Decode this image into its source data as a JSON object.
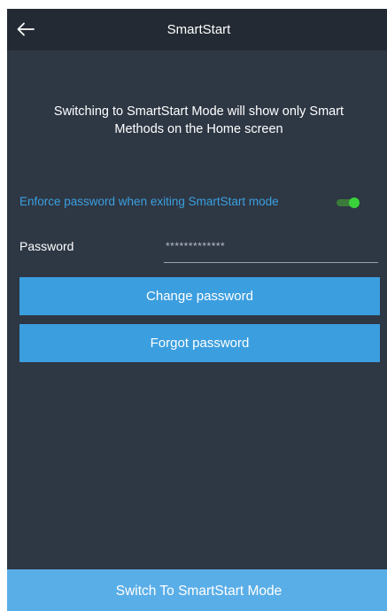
{
  "appbar": {
    "title": "SmartStart",
    "back_icon": "arrow-left-icon"
  },
  "intro": {
    "line1": "Switching to SmartStart Mode will show only Smart",
    "line2": "Methods on the Home screen"
  },
  "enforce": {
    "label": "Enforce password when exiting SmartStart mode",
    "enabled": true,
    "accent_color": "#3aa0e0",
    "toggle_on_color": "#39d23a"
  },
  "password": {
    "label": "Password",
    "value": "*************"
  },
  "buttons": {
    "change_password": "Change password",
    "forgot_password": "Forgot password"
  },
  "bottom": {
    "switch_label": "Switch To SmartStart Mode"
  },
  "colors": {
    "background": "#2e3744",
    "appbar": "#232a33",
    "button": "#3b9edf",
    "bottom_button": "#5aaee7"
  }
}
